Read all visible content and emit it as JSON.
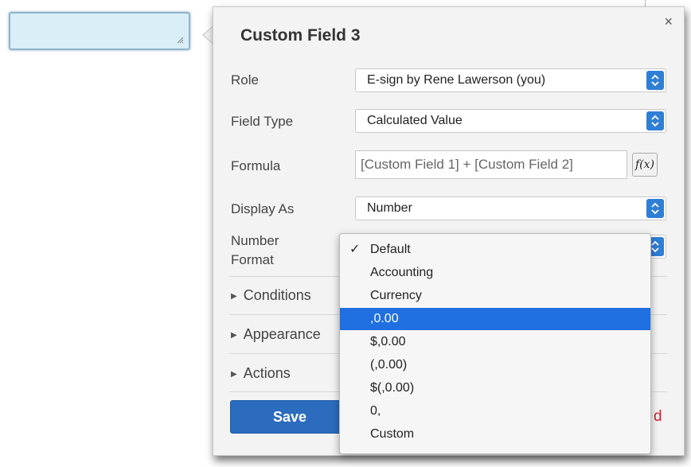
{
  "panel": {
    "title": "Custom Field 3",
    "close_label": "×",
    "fields": {
      "role": {
        "label": "Role",
        "value": "E-sign by Rene Lawerson (you)"
      },
      "field_type": {
        "label": "Field Type",
        "value": "Calculated Value"
      },
      "formula": {
        "label": "Formula",
        "value": "[Custom Field 1] + [Custom Field 2]",
        "button": "f(x)"
      },
      "display_as": {
        "label": "Display As",
        "value": "Number"
      },
      "number_format": {
        "label_line1": "Number",
        "label_line2": "Format"
      }
    },
    "sections": [
      "Conditions",
      "Appearance",
      "Actions"
    ],
    "save_label": "Save",
    "partial_red_text": "d"
  },
  "number_format_dropdown": {
    "checked_option": "Default",
    "highlighted_option": ",0.00",
    "options": [
      "Default",
      "Accounting",
      "Currency",
      ",0.00",
      "$,0.00",
      "(,0.00)",
      "$(,0.00)",
      "0,",
      "Custom"
    ]
  },
  "colors": {
    "accent": "#2f7fd7",
    "highlight": "#1f6fe0",
    "field_fill": "#d9eef6",
    "save_button": "#2b6cbf",
    "warning_text": "#d0202a"
  },
  "icons": {
    "stepper": "up-down-chevron-icon",
    "section_toggle": "triangle-right-icon",
    "check": "checkmark-icon",
    "resize": "resize-grip-icon",
    "close": "close-icon"
  }
}
